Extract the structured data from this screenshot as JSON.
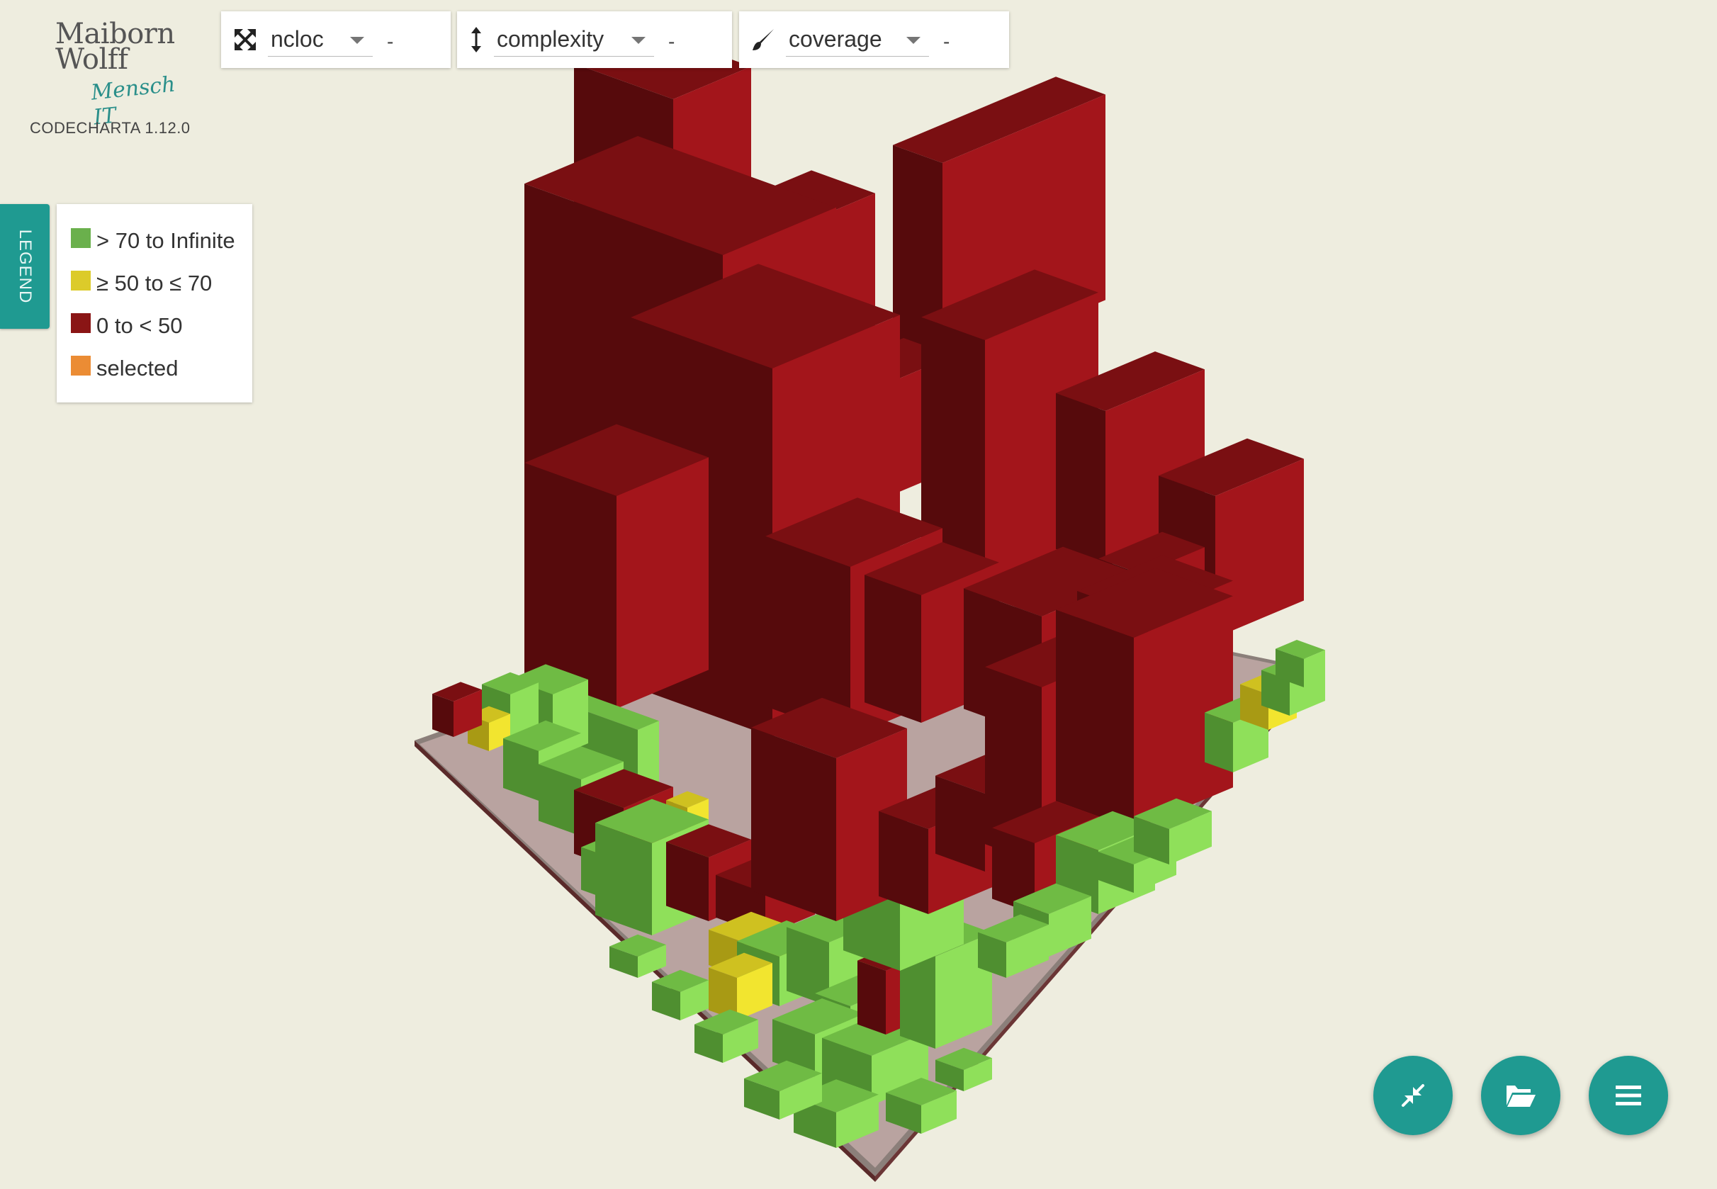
{
  "app": {
    "logo_line1": "Maiborn",
    "logo_line2": "Wolff",
    "logo_tagline": "Mensch IT",
    "version": "CODECHARTA 1.12.0"
  },
  "metrics": {
    "area": {
      "icon": "area-expand-icon",
      "label": "ncloc",
      "value": "-"
    },
    "height": {
      "icon": "height-arrow-icon",
      "label": "complexity",
      "value": "-"
    },
    "color": {
      "icon": "paint-brush-icon",
      "label": "coverage",
      "value": "-"
    }
  },
  "legend": {
    "tab_label": "LEGEND",
    "items": [
      {
        "label": "> 70 to Infinite",
        "color": "#6ab04c"
      },
      {
        "label": "≥ 50 to ≤ 70",
        "color": "#dccb2a"
      },
      {
        "label": "0 to < 50",
        "color": "#8a1515"
      },
      {
        "label": "selected",
        "color": "#eb8c34"
      }
    ]
  },
  "colors": {
    "accent": "#1f9a91",
    "background": "#eeeddf",
    "good": "#6ab04c",
    "medium": "#dccb2a",
    "bad": "#8a1515",
    "selected": "#eb8c34"
  },
  "actions": [
    {
      "name": "reset-view-button",
      "icon": "compress-arrows-icon"
    },
    {
      "name": "open-file-button",
      "icon": "folder-open-icon"
    },
    {
      "name": "menu-button",
      "icon": "hamburger-menu-icon"
    }
  ]
}
